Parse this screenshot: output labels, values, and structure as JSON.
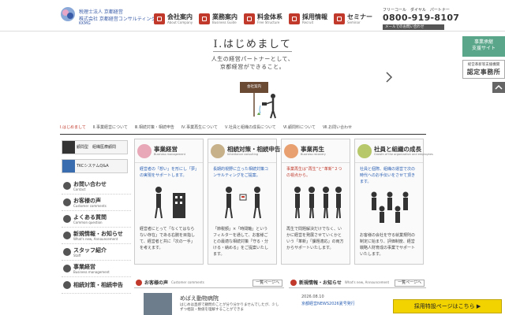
{
  "header": {
    "logo_line1": "税理士法人 京都経営",
    "logo_line2": "株式会社 京都経営コンサルティング",
    "logo_line3": "KKMG",
    "nav": [
      {
        "label": "会社案内",
        "sub": "About Company"
      },
      {
        "label": "業務案内",
        "sub": "Business Guide"
      },
      {
        "label": "料金体系",
        "sub": "Free Structure"
      },
      {
        "label": "採用情報",
        "sub": "Recruit"
      },
      {
        "label": "セミナー",
        "sub": "Seminar"
      }
    ],
    "tel_label": "フリーコール　ダイヤル　パートナー",
    "tel_number": "0800-919-8107",
    "mail_label": "メールでのお問い合わせ"
  },
  "side_right": {
    "btn1": "事業承継\n支援サイト",
    "btn2_small": "経営革新等支援機関",
    "btn2_big": "認定事務所"
  },
  "hero": {
    "title": "Ⅰ.はじめまして",
    "line1": "人生の経営パートナーとして、",
    "line2": "京都経営ができること。",
    "sign": "会社案内"
  },
  "tabs": [
    "Ⅰ.はじめまして",
    "Ⅱ.事業経営について",
    "Ⅲ.相続対策・相続申告",
    "Ⅳ.事業再生について",
    "Ⅴ.社員と組織の成長について",
    "Ⅵ.顧問料について",
    "Ⅶ.お問い合わせ"
  ],
  "left_nav": {
    "banners": [
      "顧問型　組織医療顧問",
      "TKCシステムQ&A"
    ],
    "items": [
      {
        "label": "お問い合わせ",
        "sub": "Contact"
      },
      {
        "label": "お客様の声",
        "sub": "Customer comments"
      },
      {
        "label": "よくある質問",
        "sub": "Common question"
      },
      {
        "label": "新規情報・お知らせ",
        "sub": "What's new, Announcement"
      },
      {
        "label": "スタッフ紹介",
        "sub": "Staff"
      },
      {
        "label": "事業経営",
        "sub": "Business management"
      },
      {
        "label": "相続対策・相続申告",
        "sub": ""
      }
    ]
  },
  "cards": [
    {
      "title": "事業経営",
      "sub": "Business management",
      "color": "#e8a8b8",
      "text": "経営者の「想い」を形にし「夢」の実現をサポートします。",
      "text2": "経営者にとって「なくてはならない存在」である右腕を目指して、経営者と共に「次の一手」を考えます。"
    },
    {
      "title": "相続対策・相続申告",
      "sub": "Inheritance consulting",
      "color": "#c7b18a",
      "text": "長期的視野に立った相続対策コンサルティングをご提案。",
      "text2": "「節税額」×「時間軸」というフィルターを通して、お客様ごとの最適な相続対策「守る・分ける・納める」をご提案いたします。"
    },
    {
      "title": "事業再生",
      "sub": "Business recovery",
      "color": "#e8a070",
      "text": "事業再生は“再生”と“革新”２つの視点から。",
      "text2": "再生で問題解決だけでなく、いかに経営を発展させていくかという「革新」「課題適応」の両方からサポートいたします。"
    },
    {
      "title": "社員と組織の成長",
      "sub": "Growth of the organization and employees",
      "color": "#b7c86a",
      "text": "社員と個際、組織の運営で次の時代へのお手伝いをさせて頂きます。",
      "text2": "お客様の会社を守る就業規則の制定に始まり、評価制度、経営戦略人財育成の事業でサポートいたします。"
    }
  ],
  "bottom": {
    "voice_title": "お客様の声",
    "voice_sub": "Customer comments",
    "voice_more": "一覧ページへ",
    "voice_name": "めばえ動物病院",
    "voice_text": "はじめは直感で顧問のことが分り分かりませんでしたが、少しずつ相談・数値を理解することができま",
    "news_title": "新規情報・お知らせ",
    "news_sub": "What's new, Announcement",
    "news_more": "一覧ページへ",
    "news_date": "2026.08.10",
    "news_item": "京都経営NEWS2026夏号発行",
    "recruit": "採用特設ページはこちら ▶"
  }
}
